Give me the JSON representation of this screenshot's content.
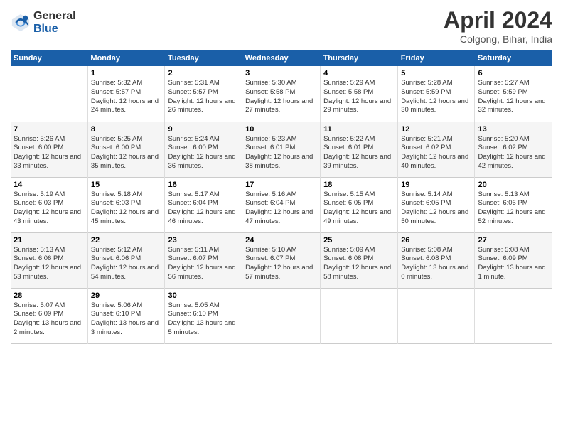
{
  "logo": {
    "general": "General",
    "blue": "Blue"
  },
  "title": "April 2024",
  "location": "Colgong, Bihar, India",
  "headers": [
    "Sunday",
    "Monday",
    "Tuesday",
    "Wednesday",
    "Thursday",
    "Friday",
    "Saturday"
  ],
  "weeks": [
    [
      {
        "day": "",
        "sunrise": "",
        "sunset": "",
        "daylight": ""
      },
      {
        "day": "1",
        "sunrise": "Sunrise: 5:32 AM",
        "sunset": "Sunset: 5:57 PM",
        "daylight": "Daylight: 12 hours and 24 minutes."
      },
      {
        "day": "2",
        "sunrise": "Sunrise: 5:31 AM",
        "sunset": "Sunset: 5:57 PM",
        "daylight": "Daylight: 12 hours and 26 minutes."
      },
      {
        "day": "3",
        "sunrise": "Sunrise: 5:30 AM",
        "sunset": "Sunset: 5:58 PM",
        "daylight": "Daylight: 12 hours and 27 minutes."
      },
      {
        "day": "4",
        "sunrise": "Sunrise: 5:29 AM",
        "sunset": "Sunset: 5:58 PM",
        "daylight": "Daylight: 12 hours and 29 minutes."
      },
      {
        "day": "5",
        "sunrise": "Sunrise: 5:28 AM",
        "sunset": "Sunset: 5:59 PM",
        "daylight": "Daylight: 12 hours and 30 minutes."
      },
      {
        "day": "6",
        "sunrise": "Sunrise: 5:27 AM",
        "sunset": "Sunset: 5:59 PM",
        "daylight": "Daylight: 12 hours and 32 minutes."
      }
    ],
    [
      {
        "day": "7",
        "sunrise": "Sunrise: 5:26 AM",
        "sunset": "Sunset: 6:00 PM",
        "daylight": "Daylight: 12 hours and 33 minutes."
      },
      {
        "day": "8",
        "sunrise": "Sunrise: 5:25 AM",
        "sunset": "Sunset: 6:00 PM",
        "daylight": "Daylight: 12 hours and 35 minutes."
      },
      {
        "day": "9",
        "sunrise": "Sunrise: 5:24 AM",
        "sunset": "Sunset: 6:00 PM",
        "daylight": "Daylight: 12 hours and 36 minutes."
      },
      {
        "day": "10",
        "sunrise": "Sunrise: 5:23 AM",
        "sunset": "Sunset: 6:01 PM",
        "daylight": "Daylight: 12 hours and 38 minutes."
      },
      {
        "day": "11",
        "sunrise": "Sunrise: 5:22 AM",
        "sunset": "Sunset: 6:01 PM",
        "daylight": "Daylight: 12 hours and 39 minutes."
      },
      {
        "day": "12",
        "sunrise": "Sunrise: 5:21 AM",
        "sunset": "Sunset: 6:02 PM",
        "daylight": "Daylight: 12 hours and 40 minutes."
      },
      {
        "day": "13",
        "sunrise": "Sunrise: 5:20 AM",
        "sunset": "Sunset: 6:02 PM",
        "daylight": "Daylight: 12 hours and 42 minutes."
      }
    ],
    [
      {
        "day": "14",
        "sunrise": "Sunrise: 5:19 AM",
        "sunset": "Sunset: 6:03 PM",
        "daylight": "Daylight: 12 hours and 43 minutes."
      },
      {
        "day": "15",
        "sunrise": "Sunrise: 5:18 AM",
        "sunset": "Sunset: 6:03 PM",
        "daylight": "Daylight: 12 hours and 45 minutes."
      },
      {
        "day": "16",
        "sunrise": "Sunrise: 5:17 AM",
        "sunset": "Sunset: 6:04 PM",
        "daylight": "Daylight: 12 hours and 46 minutes."
      },
      {
        "day": "17",
        "sunrise": "Sunrise: 5:16 AM",
        "sunset": "Sunset: 6:04 PM",
        "daylight": "Daylight: 12 hours and 47 minutes."
      },
      {
        "day": "18",
        "sunrise": "Sunrise: 5:15 AM",
        "sunset": "Sunset: 6:05 PM",
        "daylight": "Daylight: 12 hours and 49 minutes."
      },
      {
        "day": "19",
        "sunrise": "Sunrise: 5:14 AM",
        "sunset": "Sunset: 6:05 PM",
        "daylight": "Daylight: 12 hours and 50 minutes."
      },
      {
        "day": "20",
        "sunrise": "Sunrise: 5:13 AM",
        "sunset": "Sunset: 6:06 PM",
        "daylight": "Daylight: 12 hours and 52 minutes."
      }
    ],
    [
      {
        "day": "21",
        "sunrise": "Sunrise: 5:13 AM",
        "sunset": "Sunset: 6:06 PM",
        "daylight": "Daylight: 12 hours and 53 minutes."
      },
      {
        "day": "22",
        "sunrise": "Sunrise: 5:12 AM",
        "sunset": "Sunset: 6:06 PM",
        "daylight": "Daylight: 12 hours and 54 minutes."
      },
      {
        "day": "23",
        "sunrise": "Sunrise: 5:11 AM",
        "sunset": "Sunset: 6:07 PM",
        "daylight": "Daylight: 12 hours and 56 minutes."
      },
      {
        "day": "24",
        "sunrise": "Sunrise: 5:10 AM",
        "sunset": "Sunset: 6:07 PM",
        "daylight": "Daylight: 12 hours and 57 minutes."
      },
      {
        "day": "25",
        "sunrise": "Sunrise: 5:09 AM",
        "sunset": "Sunset: 6:08 PM",
        "daylight": "Daylight: 12 hours and 58 minutes."
      },
      {
        "day": "26",
        "sunrise": "Sunrise: 5:08 AM",
        "sunset": "Sunset: 6:08 PM",
        "daylight": "Daylight: 13 hours and 0 minutes."
      },
      {
        "day": "27",
        "sunrise": "Sunrise: 5:08 AM",
        "sunset": "Sunset: 6:09 PM",
        "daylight": "Daylight: 13 hours and 1 minute."
      }
    ],
    [
      {
        "day": "28",
        "sunrise": "Sunrise: 5:07 AM",
        "sunset": "Sunset: 6:09 PM",
        "daylight": "Daylight: 13 hours and 2 minutes."
      },
      {
        "day": "29",
        "sunrise": "Sunrise: 5:06 AM",
        "sunset": "Sunset: 6:10 PM",
        "daylight": "Daylight: 13 hours and 3 minutes."
      },
      {
        "day": "30",
        "sunrise": "Sunrise: 5:05 AM",
        "sunset": "Sunset: 6:10 PM",
        "daylight": "Daylight: 13 hours and 5 minutes."
      },
      {
        "day": "",
        "sunrise": "",
        "sunset": "",
        "daylight": ""
      },
      {
        "day": "",
        "sunrise": "",
        "sunset": "",
        "daylight": ""
      },
      {
        "day": "",
        "sunrise": "",
        "sunset": "",
        "daylight": ""
      },
      {
        "day": "",
        "sunrise": "",
        "sunset": "",
        "daylight": ""
      }
    ]
  ]
}
